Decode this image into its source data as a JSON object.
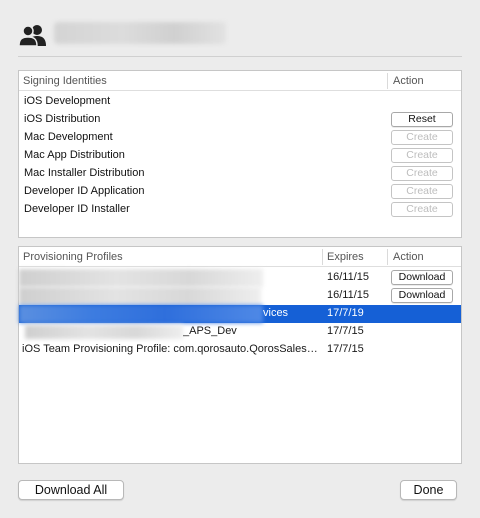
{
  "header": {
    "account_name": ""
  },
  "identities": {
    "col_name": "Signing Identities",
    "col_action": "Action",
    "rows": [
      {
        "name": "iOS Development",
        "action": null,
        "enabled": false
      },
      {
        "name": "iOS Distribution",
        "action": "Reset",
        "enabled": true
      },
      {
        "name": "Mac Development",
        "action": "Create",
        "enabled": false
      },
      {
        "name": "Mac App Distribution",
        "action": "Create",
        "enabled": false
      },
      {
        "name": "Mac Installer Distribution",
        "action": "Create",
        "enabled": false
      },
      {
        "name": "Developer ID Application",
        "action": "Create",
        "enabled": false
      },
      {
        "name": "Developer ID Installer",
        "action": "Create",
        "enabled": false
      }
    ]
  },
  "profiles": {
    "col_name": "Provisioning Profiles",
    "col_expires": "Expires",
    "col_action": "Action",
    "rows": [
      {
        "name": "",
        "visible_suffix": "",
        "expires": "16/11/15",
        "action": "Download",
        "selected": false
      },
      {
        "name": "",
        "visible_suffix": "",
        "expires": "16/11/15",
        "action": "Download",
        "selected": false
      },
      {
        "name": "",
        "visible_suffix": "vices",
        "expires": "17/7/19",
        "action": null,
        "selected": true
      },
      {
        "name": "",
        "visible_suffix": "_APS_Dev",
        "expires": "17/7/15",
        "action": null,
        "selected": false
      },
      {
        "name": "iOS Team Provisioning Profile: com.qorosauto.QorosSales…",
        "visible_suffix": "",
        "expires": "17/7/15",
        "action": null,
        "selected": false
      }
    ]
  },
  "footer": {
    "download_all": "Download All",
    "done": "Done"
  }
}
